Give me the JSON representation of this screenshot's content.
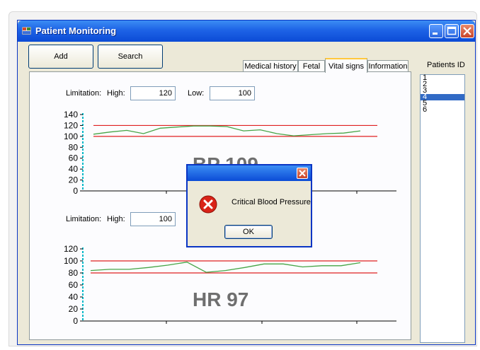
{
  "window": {
    "title": "Patient Monitoring"
  },
  "toolbar": {
    "add_label": "Add",
    "search_label": "Search"
  },
  "tabs": [
    {
      "label": "Medical history"
    },
    {
      "label": "Fetal"
    },
    {
      "label": "Vital signs",
      "active": true
    },
    {
      "label": "Information"
    }
  ],
  "patients": {
    "header": "Patients ID",
    "items": [
      "1",
      "2",
      "3",
      "4",
      "5",
      "6"
    ],
    "selected": "4"
  },
  "bp": {
    "limitation_label": "Limitation:",
    "high_label": "High:",
    "high_value": "120",
    "low_label": "Low:",
    "low_value": "100",
    "readout": "BP 109",
    "chart_data": {
      "type": "line",
      "y_ticks": [
        "140",
        "120",
        "100",
        "80",
        "60",
        "40",
        "20",
        "0"
      ],
      "ylim": [
        0,
        140
      ],
      "high_limit": 120,
      "low_limit": 100,
      "series": [
        {
          "values": [
            104,
            108,
            111,
            105,
            115,
            117,
            119,
            119,
            118,
            110,
            112,
            105,
            101,
            103,
            105,
            106,
            110
          ]
        }
      ]
    }
  },
  "hr": {
    "limitation_label": "Limitation:",
    "high_label": "High:",
    "high_value": "100",
    "readout": "HR 97",
    "chart_data": {
      "type": "line",
      "y_ticks": [
        "120",
        "100",
        "80",
        "60",
        "40",
        "20",
        "0"
      ],
      "ylim": [
        0,
        120
      ],
      "high_limit": 100,
      "low_limit": 80,
      "series": [
        {
          "values": [
            84,
            86,
            86,
            89,
            93,
            98,
            81,
            84,
            89,
            95,
            95,
            90,
            92,
            92,
            97
          ]
        }
      ]
    }
  },
  "dialog": {
    "message": "Critical Blood Pressure",
    "ok_label": "OK"
  },
  "colors": {
    "limit_line": "#e02020",
    "series_line": "#46a546",
    "axis_dash": "#00b8c8",
    "readout_text": "#6f6f6f",
    "selection": "#316ac5"
  }
}
